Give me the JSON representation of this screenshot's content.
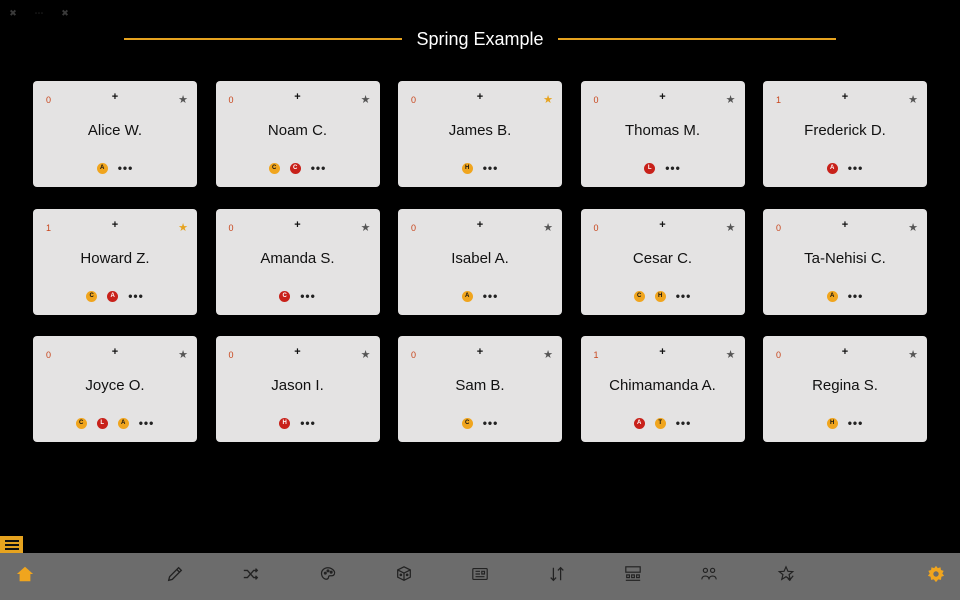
{
  "window_controls": [
    "✖",
    "⋯",
    "✖"
  ],
  "title": "Spring Example",
  "colors": {
    "accent": "#e6a31f",
    "tag_amber": "#f0a51e",
    "tag_red": "#c8211a",
    "count": "#c8441a",
    "card_bg": "#e4e3e3",
    "bar_bg": "#6c6c6c"
  },
  "cards": [
    {
      "name": "Alice W.",
      "count": "0",
      "plus": "+",
      "star": "★",
      "favorite": false,
      "tags": [
        {
          "letter": "A",
          "color": "amber"
        }
      ],
      "more": "•••"
    },
    {
      "name": "Noam C.",
      "count": "0",
      "plus": "+",
      "star": "★",
      "favorite": false,
      "tags": [
        {
          "letter": "C",
          "color": "amber"
        },
        {
          "letter": "C",
          "color": "red"
        }
      ],
      "more": "•••"
    },
    {
      "name": "James B.",
      "count": "0",
      "plus": "+",
      "star": "★",
      "favorite": true,
      "tags": [
        {
          "letter": "H",
          "color": "amber"
        }
      ],
      "more": "•••"
    },
    {
      "name": "Thomas M.",
      "count": "0",
      "plus": "+",
      "star": "★",
      "favorite": false,
      "tags": [
        {
          "letter": "L",
          "color": "red"
        }
      ],
      "more": "•••"
    },
    {
      "name": "Frederick D.",
      "count": "1",
      "plus": "+",
      "star": "★",
      "favorite": false,
      "tags": [
        {
          "letter": "A",
          "color": "red"
        }
      ],
      "more": "•••"
    },
    {
      "name": "Howard Z.",
      "count": "1",
      "plus": "+",
      "star": "★",
      "favorite": true,
      "tags": [
        {
          "letter": "C",
          "color": "amber"
        },
        {
          "letter": "A",
          "color": "red"
        }
      ],
      "more": "•••"
    },
    {
      "name": "Amanda S.",
      "count": "0",
      "plus": "+",
      "star": "★",
      "favorite": false,
      "tags": [
        {
          "letter": "C",
          "color": "red"
        }
      ],
      "more": "•••"
    },
    {
      "name": "Isabel A.",
      "count": "0",
      "plus": "+",
      "star": "★",
      "favorite": false,
      "tags": [
        {
          "letter": "A",
          "color": "amber"
        }
      ],
      "more": "•••"
    },
    {
      "name": "Cesar C.",
      "count": "0",
      "plus": "+",
      "star": "★",
      "favorite": false,
      "tags": [
        {
          "letter": "C",
          "color": "amber"
        },
        {
          "letter": "H",
          "color": "amber"
        }
      ],
      "more": "•••"
    },
    {
      "name": "Ta-Nehisi C.",
      "count": "0",
      "plus": "+",
      "star": "★",
      "favorite": false,
      "tags": [
        {
          "letter": "A",
          "color": "amber"
        }
      ],
      "more": "•••"
    },
    {
      "name": "Joyce O.",
      "count": "0",
      "plus": "+",
      "star": "★",
      "favorite": false,
      "tags": [
        {
          "letter": "C",
          "color": "amber"
        },
        {
          "letter": "L",
          "color": "red"
        },
        {
          "letter": "A",
          "color": "amber"
        }
      ],
      "more": "•••"
    },
    {
      "name": "Jason I.",
      "count": "0",
      "plus": "+",
      "star": "★",
      "favorite": false,
      "tags": [
        {
          "letter": "H",
          "color": "red"
        }
      ],
      "more": "•••"
    },
    {
      "name": "Sam B.",
      "count": "0",
      "plus": "+",
      "star": "★",
      "favorite": false,
      "tags": [
        {
          "letter": "C",
          "color": "amber"
        }
      ],
      "more": "•••"
    },
    {
      "name": "Chimamanda A.",
      "count": "1",
      "plus": "+",
      "star": "★",
      "favorite": false,
      "tags": [
        {
          "letter": "A",
          "color": "red"
        },
        {
          "letter": "T",
          "color": "amber"
        }
      ],
      "more": "•••"
    },
    {
      "name": "Regina S.",
      "count": "0",
      "plus": "+",
      "star": "★",
      "favorite": false,
      "tags": [
        {
          "letter": "H",
          "color": "amber"
        }
      ],
      "more": "•••"
    }
  ],
  "bottom_nav": [
    {
      "icon": "home-icon",
      "active": true
    },
    {
      "icon": "pencil-icon",
      "active": false
    },
    {
      "icon": "shuffle-icon",
      "active": false
    },
    {
      "icon": "palette-icon",
      "active": false
    },
    {
      "icon": "dice-icon",
      "active": false
    },
    {
      "icon": "newspaper-icon",
      "active": false
    },
    {
      "icon": "sort-icon",
      "active": false
    },
    {
      "icon": "seating-chart-icon",
      "active": false
    },
    {
      "icon": "groups-icon",
      "active": false
    },
    {
      "icon": "star-check-icon",
      "active": false
    },
    {
      "icon": "gear-icon",
      "active": true
    }
  ]
}
